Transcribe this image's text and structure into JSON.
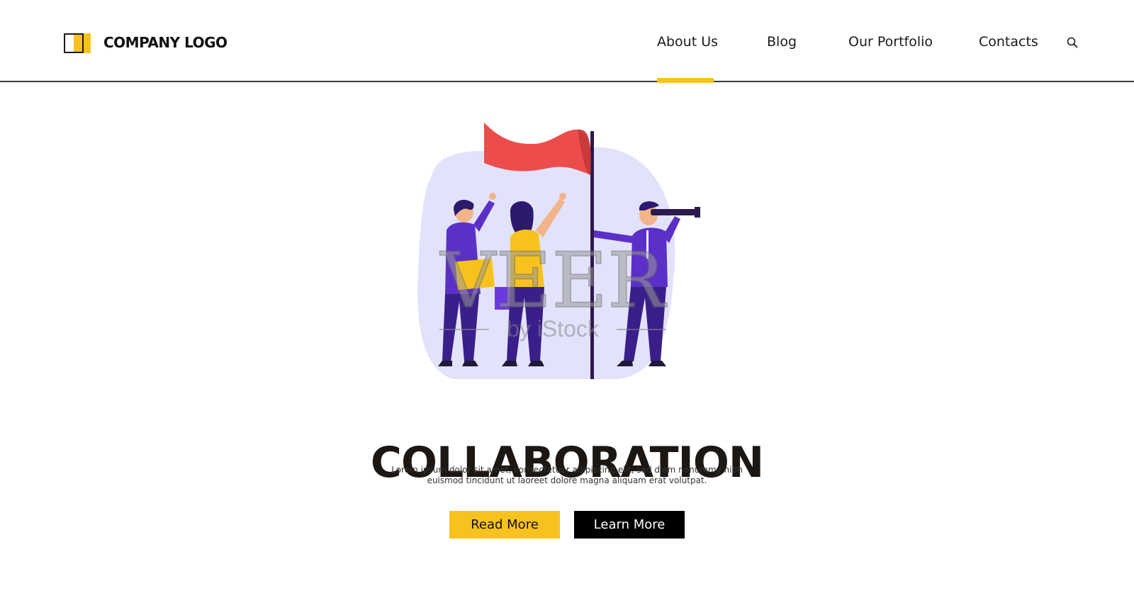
{
  "header": {
    "logo_text": "COMPANY LOGO",
    "nav": [
      {
        "label": "About Us",
        "active": true
      },
      {
        "label": "Blog",
        "active": false
      },
      {
        "label": "Our Portfolio",
        "active": false
      },
      {
        "label": "Contacts",
        "active": false
      }
    ],
    "search_icon": "search-icon"
  },
  "hero": {
    "title": "COLLABORATION",
    "description_line1": "Lorem ipsum dolor sit amet, consectetuer adipiscing elit, sed diam nonummy nibh",
    "description_line2": "euismod tincidunt ut laoreet dolore magna aliquam erat volutpat.",
    "read_more_label": "Read More",
    "learn_more_label": "Learn More"
  },
  "illustration": {
    "watermark_main": "VEER",
    "watermark_sub": "by iStock"
  },
  "colors": {
    "accent": "#f7c21d",
    "dark": "#000000",
    "blob": "#e3e2fb",
    "flag": "#ec4c4c",
    "figure_purple": "#5a30c8",
    "figure_navy": "#2b1a6e"
  }
}
